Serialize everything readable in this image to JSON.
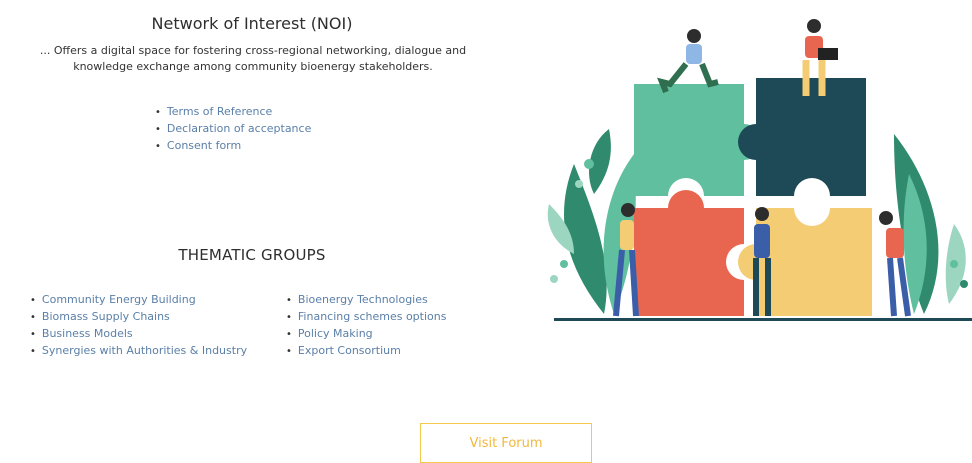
{
  "noi": {
    "title": "Network of Interest (NOI)",
    "description": "... Offers a digital space for fostering cross-regional networking, dialogue and knowledge exchange among community bioenergy stakeholders.",
    "links": [
      "Terms of Reference",
      "Declaration of acceptance",
      "Consent form"
    ]
  },
  "thematic_groups": {
    "title": "THEMATIC GROUPS",
    "left": [
      "Community Energy Building",
      "Biomass Supply Chains",
      "Business Models",
      "Synergies with Authorities & Industry"
    ],
    "right": [
      "Bioenergy Technologies",
      "Financing schemes options",
      "Policy Making",
      "Export Consortium"
    ]
  },
  "forum": {
    "button_label": "Visit Forum"
  },
  "colors": {
    "link": "#5a7fa8",
    "button_accent": "#f2c94c",
    "puzzle_teal": "#5fbf9f",
    "puzzle_dark": "#1e4a57",
    "puzzle_red": "#e8664f",
    "puzzle_yellow": "#f3cc74"
  },
  "illustration": {
    "icon": "puzzle-team-illustration"
  }
}
